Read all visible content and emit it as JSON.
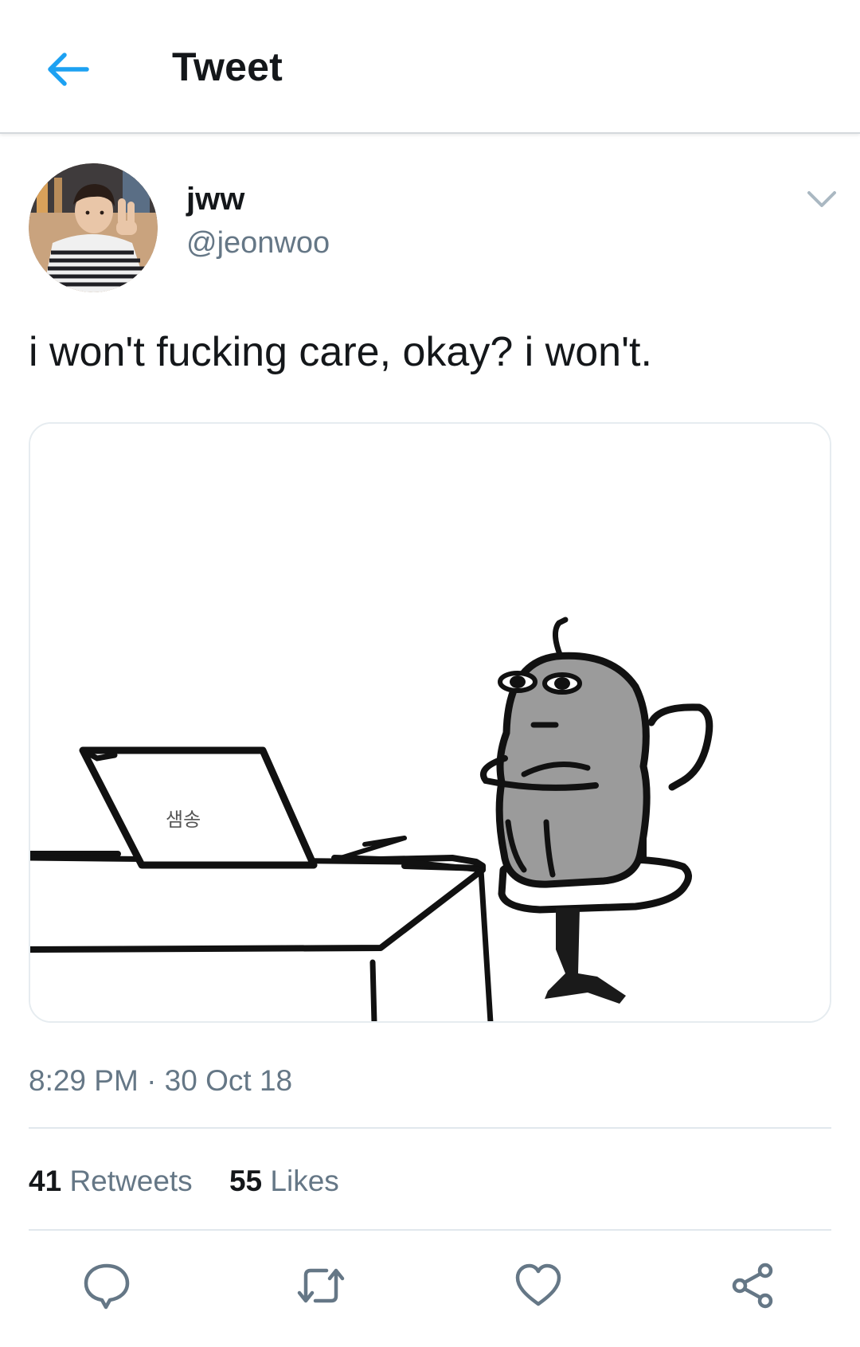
{
  "header": {
    "back_icon": "arrow-left-icon",
    "title": "Tweet",
    "accent_color": "#1da1f2"
  },
  "tweet": {
    "author": {
      "display_name": "jww",
      "handle": "@jeonwoo",
      "avatar_icon": "profile-photo"
    },
    "menu_icon": "chevron-down-icon",
    "text": "i won't fucking care, okay? i won't.",
    "media": {
      "type": "image",
      "paper_label": "샘송"
    },
    "time": "8:29 PM · 30 Oct 18",
    "stats": {
      "retweets_count": "41",
      "retweets_label": "Retweets",
      "likes_count": "55",
      "likes_label": "Likes"
    },
    "actions": [
      {
        "name": "reply",
        "icon": "speech-bubble-icon"
      },
      {
        "name": "retweet",
        "icon": "retweet-arrows-icon"
      },
      {
        "name": "like",
        "icon": "heart-icon"
      },
      {
        "name": "share",
        "icon": "share-nodes-icon"
      }
    ]
  },
  "colors": {
    "text_primary": "#14171a",
    "text_secondary": "#657786",
    "icon_gray": "#657786",
    "divider": "#e1e8ed"
  }
}
